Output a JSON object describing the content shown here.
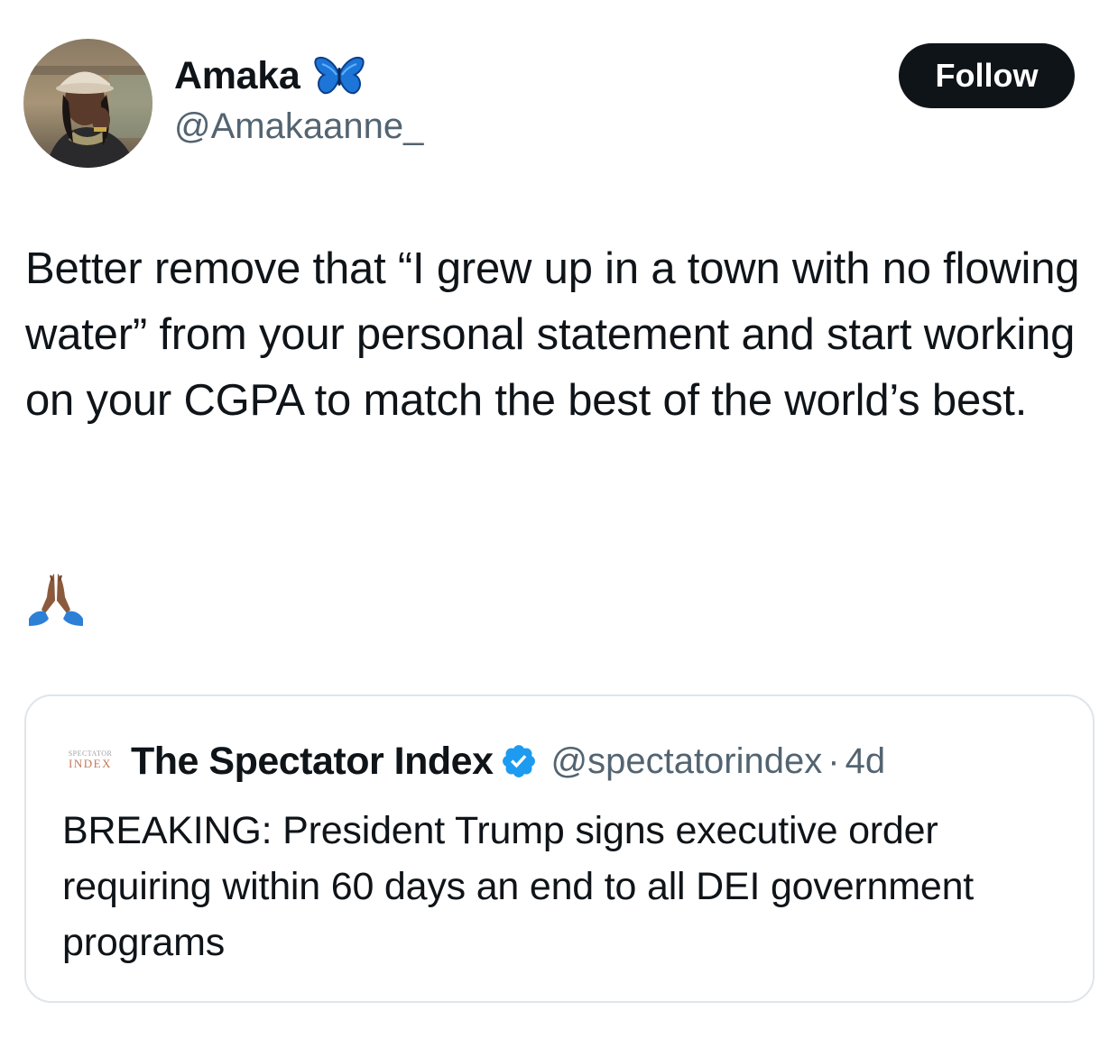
{
  "tweet": {
    "author": {
      "name": "Amaka",
      "badge_icon": "blue-butterfly-icon",
      "handle": "@Amakaanne_",
      "avatar_icon": "avatar-photo"
    },
    "follow_label": "Follow",
    "text": "Better remove that “I grew up in a town with no flowing water” from your personal statement and start working on your CGPA to match the best of the world’s best.",
    "emoji": "🙏🏾",
    "emoji_icon": "folded-hands-emoji"
  },
  "quote": {
    "avatar_icon": "spectator-index-logo",
    "avatar_logo_text": [
      "SPECTATOR",
      "INDEX"
    ],
    "name": "The Spectator Index",
    "verified_icon": "verified-badge-icon",
    "handle": "@spectatorindex",
    "separator": "·",
    "time": "4d",
    "text": "BREAKING: President Trump signs executive order requiring within 60 days an end to all DEI government programs"
  },
  "colors": {
    "text_primary": "#0f1419",
    "text_secondary": "#536471",
    "follow_bg": "#0f1419",
    "verified_blue": "#1d9bf0",
    "card_border": "#dfe5e9"
  }
}
